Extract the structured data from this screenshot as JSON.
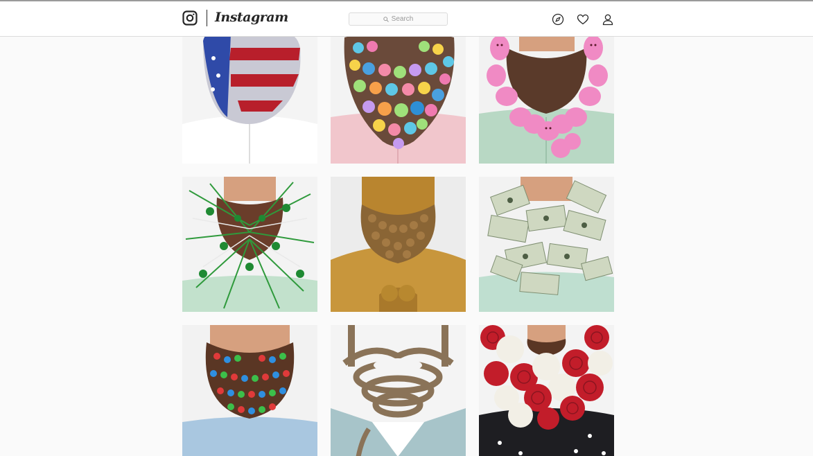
{
  "header": {
    "brand": "Instagram",
    "search_placeholder": "Search",
    "icons": [
      "instagram-logo-icon",
      "compass-icon",
      "heart-icon",
      "profile-icon"
    ]
  },
  "colors": {
    "navbar_bg": "#ffffff",
    "page_bg": "#fafafa",
    "border": "#dbdbdb",
    "text": "#262626"
  },
  "grid": {
    "rows": [
      [
        {
          "id": "post-1",
          "theme": "american-flag-beard",
          "shirt": "#ffffff"
        },
        {
          "id": "post-2",
          "theme": "easter-egg-candy-beard",
          "shirt": "#f1c6cc"
        },
        {
          "id": "post-3",
          "theme": "pink-peeps-beard",
          "shirt": "#b8d8c4"
        }
      ],
      [
        {
          "id": "post-4",
          "theme": "shamrock-sparkle-beard",
          "shirt": "#c2e1cc"
        },
        {
          "id": "post-5",
          "theme": "gold-curly-beard",
          "shirt": "#c8963c"
        },
        {
          "id": "post-6",
          "theme": "dollar-bills-beard",
          "shirt": "#bfdfd0"
        }
      ],
      [
        {
          "id": "post-7",
          "theme": "gumball-beard",
          "shirt": "#a9c7e0"
        },
        {
          "id": "post-8",
          "theme": "knotted-rope-beard",
          "shirt": "#a7c4c9"
        },
        {
          "id": "post-9",
          "theme": "roses-beard",
          "shirt": "#1e1e22"
        }
      ]
    ]
  }
}
